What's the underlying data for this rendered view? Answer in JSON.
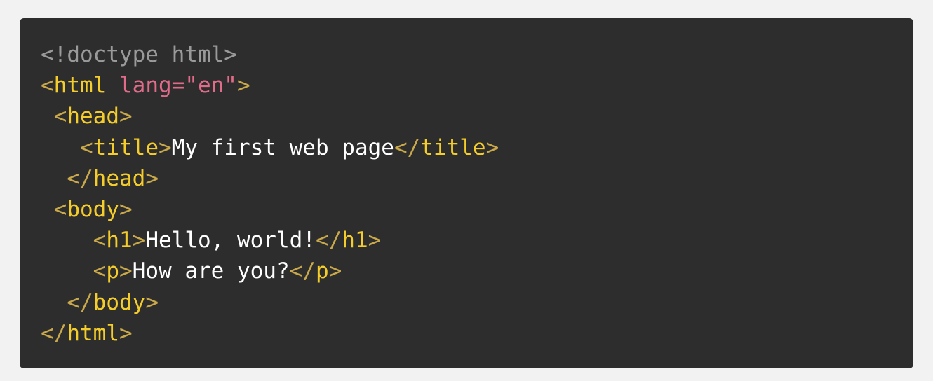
{
  "code": {
    "lines": [
      {
        "indent": "",
        "doctype": "<!doctype html>"
      },
      {
        "indent": "",
        "open": "<",
        "tag": "html",
        "space": " ",
        "attr": "lang=\"en\"",
        "close": ">"
      },
      {
        "indent": " ",
        "open": "<",
        "tag": "head",
        "close": ">"
      },
      {
        "indent": "   ",
        "open": "<",
        "tag": "title",
        "close": ">",
        "text": "My first web page",
        "open2": "</",
        "tag2": "title",
        "close2": ">"
      },
      {
        "indent": "  ",
        "open": "</",
        "tag": "head",
        "close": ">"
      },
      {
        "indent": " ",
        "open": "<",
        "tag": "body",
        "close": ">"
      },
      {
        "indent": "    ",
        "open": "<",
        "tag": "h1",
        "close": ">",
        "text": "Hello, world!",
        "open2": "</",
        "tag2": "h1",
        "close2": ">"
      },
      {
        "indent": "    ",
        "open": "<",
        "tag": "p",
        "close": ">",
        "text": "How are you?",
        "open2": "</",
        "tag2": "p",
        "close2": ">"
      },
      {
        "indent": "  ",
        "open": "</",
        "tag": "body",
        "close": ">"
      },
      {
        "indent": "",
        "open": "</",
        "tag": "html",
        "close": ">"
      }
    ]
  },
  "colors": {
    "page_background": "#f2f2f2",
    "code_background": "#2d2d2d",
    "punctuation": "#c9a94a",
    "tag_name": "#f5cd2a",
    "attribute": "#e06c8a",
    "doctype": "#9a9a9a",
    "text": "#ffffff"
  }
}
